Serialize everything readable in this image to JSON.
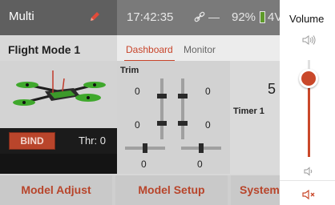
{
  "topbar": {
    "model_name": "Multi",
    "time": "17:42:35",
    "link_status": "—",
    "battery_percent": "92%",
    "battery_voltage": "4V"
  },
  "left_panel": {
    "flight_mode": "Flight Mode 1",
    "bind_label": "BIND",
    "throttle": "Thr: 0"
  },
  "tabs": {
    "dashboard": "Dashboard",
    "monitor": "Monitor"
  },
  "trim": {
    "title": "Trim",
    "values": {
      "left_vertical_value": "0",
      "right_vertical_value": "0",
      "left_vertical_value_2": "0",
      "right_vertical_value_2": "0",
      "left_horizontal_value": "0",
      "right_horizontal_value": "0"
    }
  },
  "timer": {
    "big_value": "5",
    "label": "Timer 1"
  },
  "bottom_buttons": {
    "model_adjust": "Model Adjust",
    "model_setup": "Model Setup",
    "system": "System"
  },
  "volume": {
    "title": "Volume",
    "level": 0.81
  },
  "colors": {
    "accent": "#c9482a",
    "topbar": "#5f5f5f",
    "panel": "#d8d8d8"
  },
  "icons": {
    "edit": "pencil-icon",
    "link": "link-icon",
    "battery": "battery-icon",
    "volume_up": "speaker-icon",
    "volume_down": "speaker-low-icon",
    "mute": "mute-icon"
  }
}
